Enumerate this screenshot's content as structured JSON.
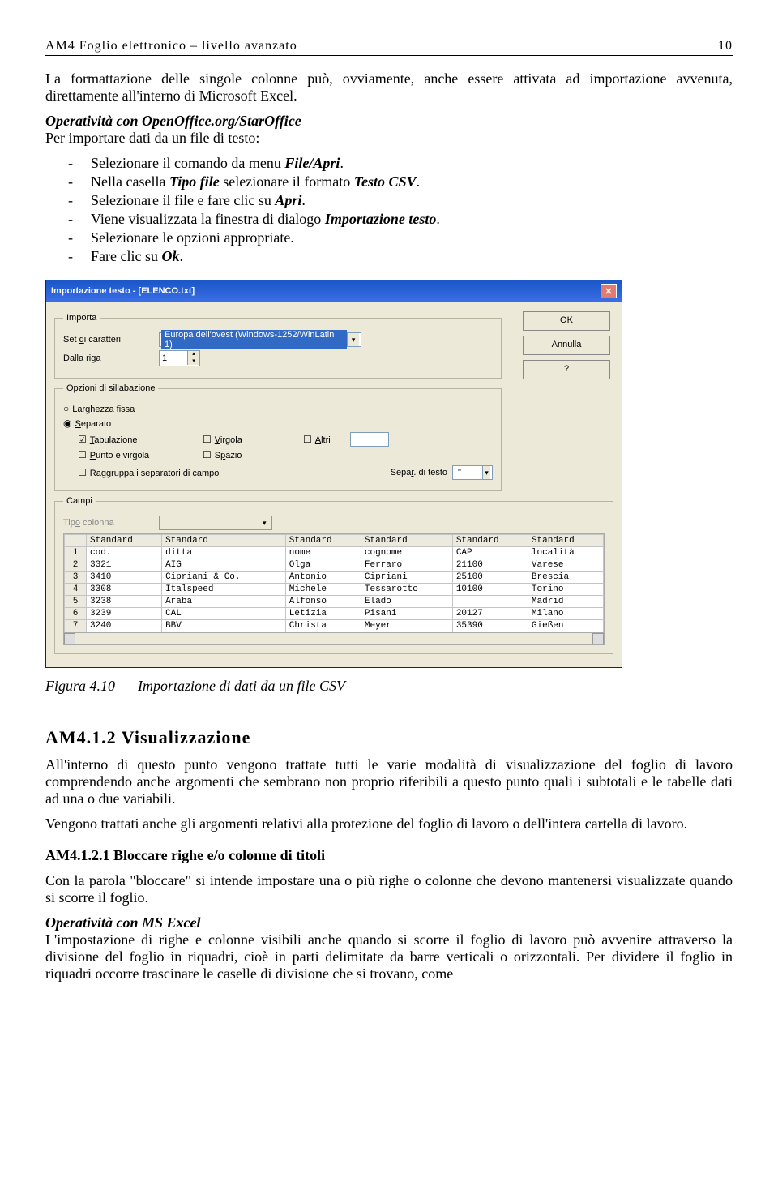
{
  "header": {
    "left": "AM4 Foglio elettronico – livello avanzato",
    "right": "10"
  },
  "intro": "La formattazione delle singole colonne può, ovviamente, anche essere attivata ad importazione avvenuta, direttamente all'interno di Microsoft Excel.",
  "oo_heading": "Operatività con OpenOffice.org/StarOffice",
  "oo_line": "Per importare dati da un file di testo:",
  "steps": [
    "Selezionare il comando da menu File/Apri.",
    "Nella casella Tipo file selezionare il formato Testo CSV.",
    "Selezionare il file e fare clic su Apri.",
    "Viene visualizzata la finestra di dialogo Importazione testo.",
    "Selezionare le opzioni appropriate.",
    "Fare clic su Ok."
  ],
  "dialog": {
    "title": "Importazione testo - [ELENCO.txt]",
    "fs_importa": "Importa",
    "set_caratteri": "Set di caratteri",
    "encoding": "Europa dell'ovest (Windows-1252/WinLatin 1)",
    "dalla_riga": "Dalla riga",
    "riga_val": "1",
    "fs_sillab": "Opzioni di sillabazione",
    "larghezza": "Larghezza fissa",
    "separato": "Separato",
    "tabulazione": "Tabulazione",
    "virgola": "Virgola",
    "altri": "Altri",
    "punto": "Punto e virgola",
    "spazio": "Spazio",
    "raggruppa": "Raggruppa i separatori di campo",
    "separ": "Separ. di testo",
    "separ_val": "\"",
    "fs_campi": "Campi",
    "tipo_col": "Tipo colonna",
    "ok": "OK",
    "annulla": "Annulla",
    "help": "?",
    "cols": [
      "Standard",
      "Standard",
      "Standard",
      "Standard",
      "Standard",
      "Standard"
    ],
    "rows": [
      [
        "1",
        "cod.",
        "ditta",
        "nome",
        "cognome",
        "CAP",
        "località"
      ],
      [
        "2",
        "3321",
        "AIG",
        "Olga",
        "Ferraro",
        "21100",
        "Varese"
      ],
      [
        "3",
        "3410",
        "Cipriani & Co.",
        "Antonio",
        "Cipriani",
        "25100",
        "Brescia"
      ],
      [
        "4",
        "3308",
        "Italspeed",
        "Michele",
        "Tessarotto",
        "10100",
        "Torino"
      ],
      [
        "5",
        "3238",
        "Araba",
        "Alfonso",
        "Elado",
        "",
        "Madrid"
      ],
      [
        "6",
        "3239",
        "CAL",
        "Letizia",
        "Pisani",
        "20127",
        "Milano"
      ],
      [
        "7",
        "3240",
        "BBV",
        "Christa",
        "Meyer",
        "35390",
        "Gießen"
      ]
    ]
  },
  "fig": {
    "num": "Figura 4.10",
    "cap": "Importazione di dati da un file CSV"
  },
  "sec412": {
    "title": "AM4.1.2    Visualizzazione",
    "body": "All'interno di questo punto vengono trattate tutti le varie modalità di visualizzazione del foglio di lavoro comprendendo anche argomenti che sembrano non proprio riferibili a questo punto quali i subtotali e le tabelle dati ad una o due variabili.",
    "body2": "Vengono trattati anche gli argomenti relativi alla protezione del foglio di lavoro o dell'intera cartella di lavoro."
  },
  "sec4121": {
    "title": "AM4.1.2.1    Bloccare righe e/o colonne di titoli",
    "body": "Con la parola \"bloccare\" si intende impostare una o più righe o colonne che devono mantenersi visualizzate quando si scorre il foglio."
  },
  "msexcel": {
    "heading": "Operatività con MS Excel",
    "body": "L'impostazione di righe e colonne visibili anche quando si scorre il foglio di lavoro può avvenire attraverso la divisione del foglio in riquadri, cioè in parti delimitate da barre verticali o orizzontali. Per dividere il foglio in riquadri occorre trascinare le caselle di divisione che si trovano, come"
  }
}
